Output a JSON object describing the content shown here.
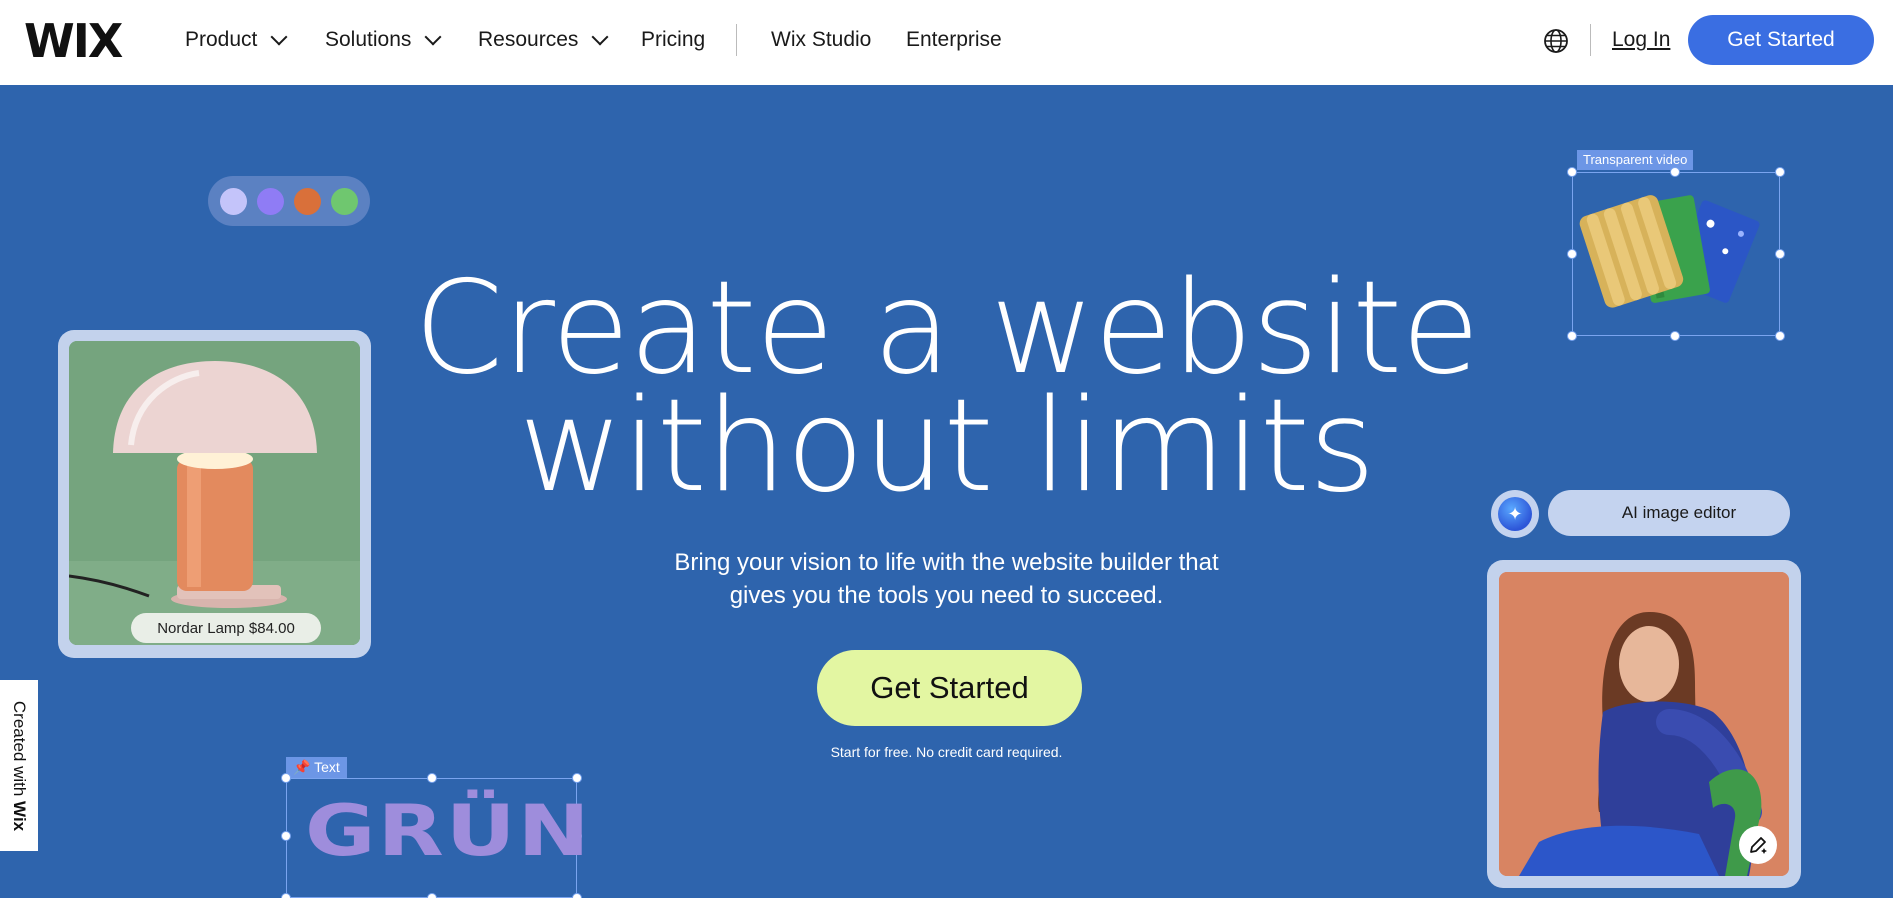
{
  "nav": {
    "logo": "WIX",
    "items": [
      {
        "label": "Product",
        "dropdown": true
      },
      {
        "label": "Solutions",
        "dropdown": true
      },
      {
        "label": "Resources",
        "dropdown": true
      },
      {
        "label": "Pricing",
        "dropdown": false
      },
      {
        "label": "Wix Studio",
        "dropdown": false
      },
      {
        "label": "Enterprise",
        "dropdown": false
      }
    ],
    "language_icon": "globe-icon",
    "login": "Log In",
    "cta": "Get Started"
  },
  "hero": {
    "title_line1": "Create a website",
    "title_line2": "without limits",
    "subtitle_line1": "Bring your vision to life with the website builder that",
    "subtitle_line2": "gives you the tools you need to succeed.",
    "cta": "Get Started",
    "note": "Start for free. No credit card required."
  },
  "swatches": [
    "#c4c4fa",
    "#8f7cf5",
    "#d9703a",
    "#6fc76f"
  ],
  "lamp_card": {
    "caption": "Nordar Lamp $84.00"
  },
  "transparent_video": {
    "tag": "Transparent video"
  },
  "ai_editor": {
    "label": "AI image editor",
    "icon": "sparkle-icon",
    "edit_icon": "pencil-sparkle-icon"
  },
  "text_element": {
    "tag": "Text",
    "tag_icon": "pin-icon",
    "sample": "GRÜN"
  },
  "side_tab": {
    "prefix": "Created with ",
    "brand": "Wix"
  },
  "colors": {
    "background": "#2e64ad",
    "primary_button": "#3a6ee2",
    "hero_button": "#e3f6a2"
  }
}
